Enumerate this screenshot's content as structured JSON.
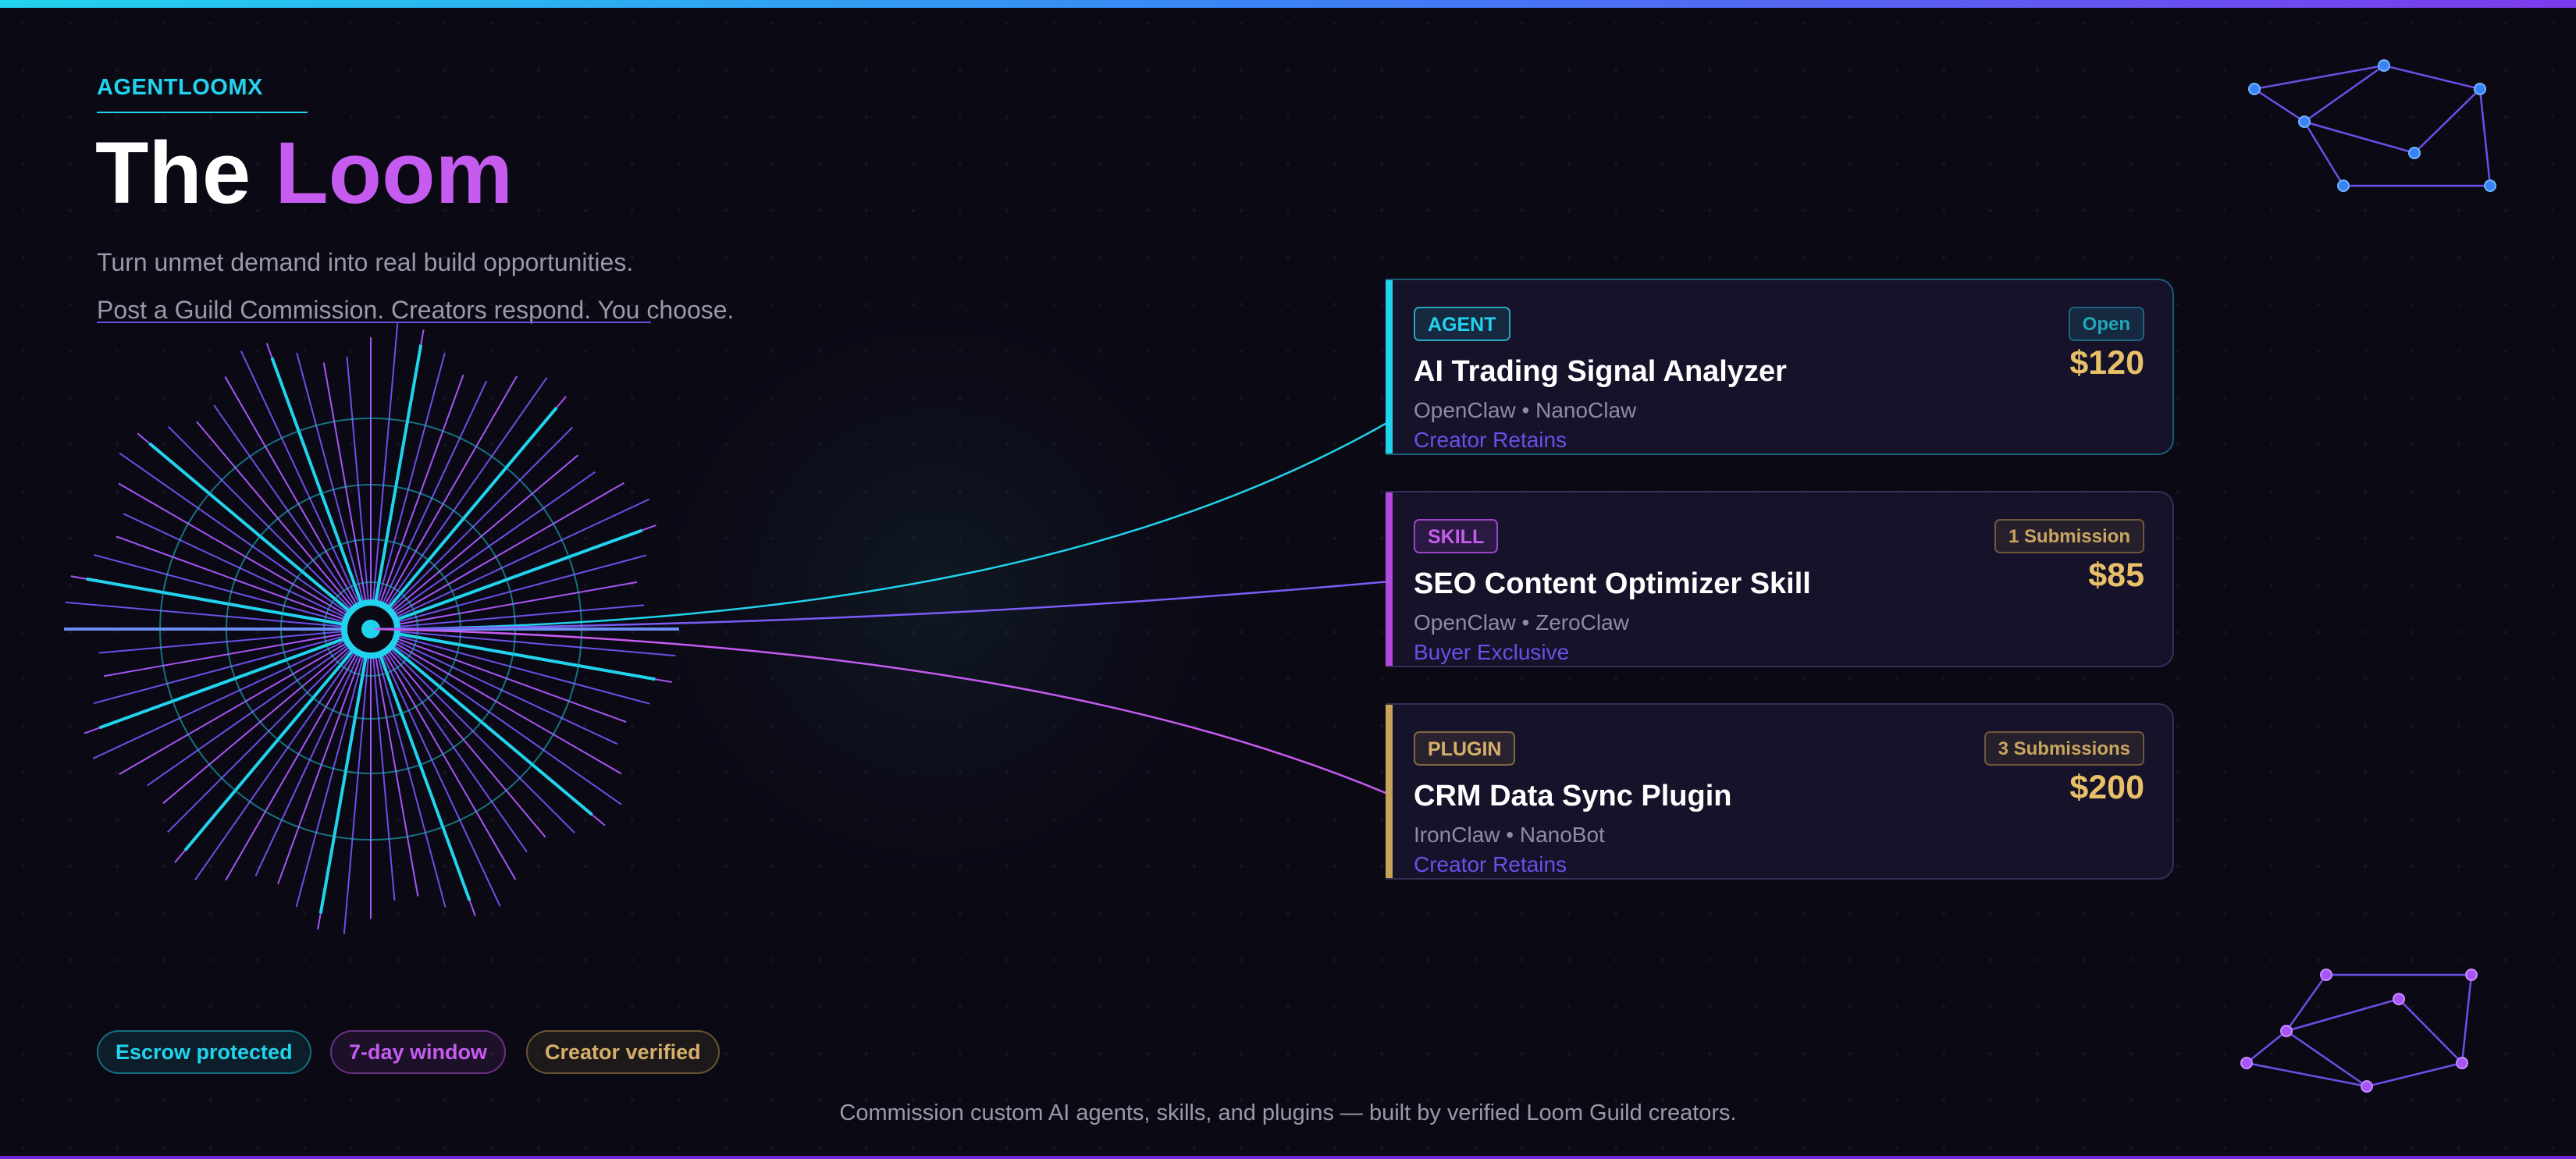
{
  "brand": "AGENTLOOMX",
  "title": {
    "word1": "The",
    "word2": "Loom"
  },
  "tagline": {
    "line1": "Turn unmet demand into real build opportunities.",
    "line2": "Post a Guild Commission. Creators respond. You choose."
  },
  "cards": [
    {
      "badge": "AGENT",
      "status": "Open",
      "price": "$120",
      "name": "AI Trading Signal Analyzer",
      "meta": "OpenClaw • NanoClaw",
      "rights": "Creator Retains"
    },
    {
      "badge": "SKILL",
      "status": "1 Submission",
      "price": "$85",
      "name": "SEO Content Optimizer Skill",
      "meta": "OpenClaw • ZeroClaw",
      "rights": "Buyer Exclusive"
    },
    {
      "badge": "PLUGIN",
      "status": "3 Submissions",
      "price": "$200",
      "name": "CRM Data Sync Plugin",
      "meta": "IronClaw • NanoBot",
      "rights": "Creator Retains"
    }
  ],
  "chips": [
    "Escrow protected",
    "7-day window",
    "Creator verified"
  ],
  "footer": "Commission custom AI agents, skills, and plugins — built by verified Loom Guild creators.",
  "colors": {
    "cyan": "#22d3ee",
    "purple": "#c65bf0",
    "violet": "#7c5cf5",
    "gold": "#d6b06a",
    "background": "#0b0914"
  }
}
